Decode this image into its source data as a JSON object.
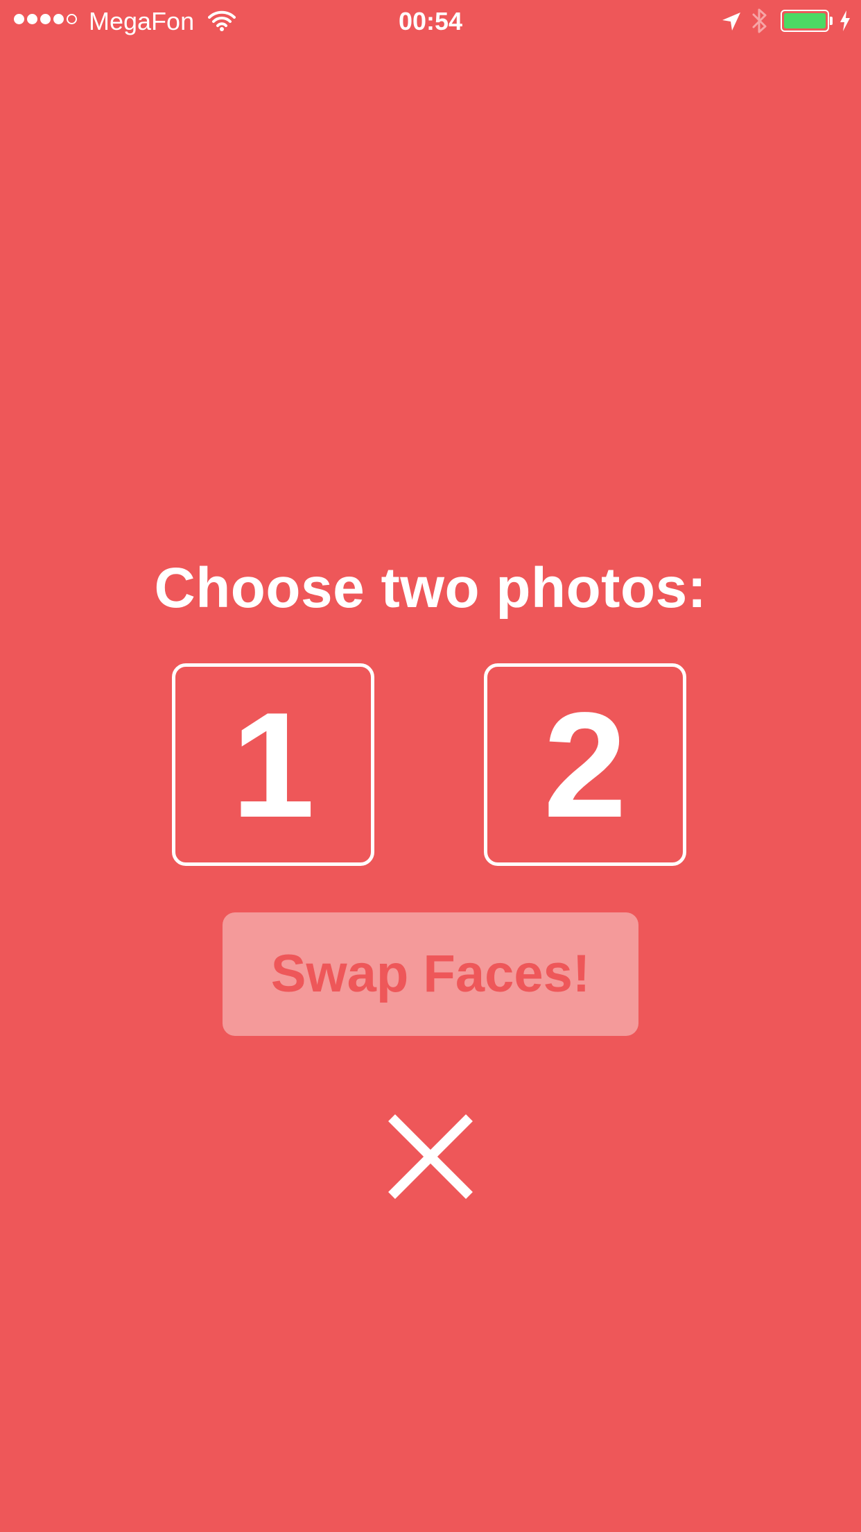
{
  "status_bar": {
    "signal_bars_filled": 4,
    "signal_bars_total": 5,
    "carrier": "MegaFon",
    "time": "00:54",
    "battery_level": 1.0,
    "charging": true,
    "icons": [
      "wifi-icon",
      "location-icon",
      "bluetooth-icon",
      "battery-icon",
      "charging-icon"
    ]
  },
  "main": {
    "heading": "Choose two photos:",
    "slots": [
      {
        "label": "1"
      },
      {
        "label": "2"
      }
    ],
    "swap_button_label": "Swap Faces!",
    "close_icon": "close-icon"
  },
  "colors": {
    "background": "#ee5759",
    "foreground": "#ffffff",
    "button_disabled": "#f49a9a",
    "battery": "#4cd964"
  }
}
